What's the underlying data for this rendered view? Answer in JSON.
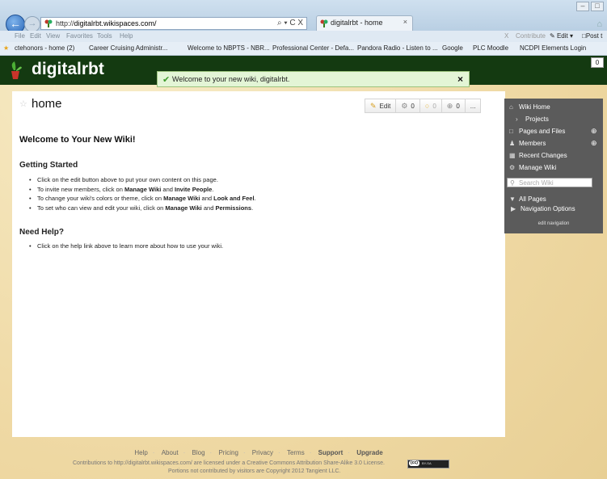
{
  "browser": {
    "url_prefix": "http://",
    "url_host": "digitalrbt.wikispaces.com/",
    "url_controls": "⌕ ▾ C X",
    "tab_title": "digitalrbt - home",
    "tab_close": "×",
    "menu": [
      "File",
      "Edit",
      "View",
      "Favorites",
      "Tools",
      "Help"
    ],
    "commands": {
      "close": "X",
      "contribute": "Contribute",
      "edit": "Edit",
      "post": "Post t"
    },
    "favorites": [
      "ctehonors - home (2)",
      "Career Cruising Administr...",
      "Welcome to NBPTS - NBR...",
      "Professional Center - Defa...",
      "Pandora Radio - Listen to ...",
      "Google",
      "PLC Moodle",
      "NCDPI Elements Login"
    ]
  },
  "wiki": {
    "site_title": "digitalrbt",
    "header_count": "0",
    "notice": "Welcome to your new wiki, digitalrbt.",
    "notice_close": "×",
    "page_title": "home",
    "toolbar": {
      "edit": "Edit",
      "history_count": "0",
      "comments_count": "0",
      "follow_count": "0",
      "more": "..."
    },
    "content": {
      "welcome_heading": "Welcome to Your New Wiki!",
      "getting_started_heading": "Getting Started",
      "gs_items": [
        {
          "text": "Click on the edit button above to put your own content on this page."
        },
        {
          "pre": "To invite new members, click on ",
          "b1": "Manage Wiki",
          "mid": " and ",
          "b2": "Invite People",
          "post": "."
        },
        {
          "pre": "To change your wiki's colors or theme, click on ",
          "b1": "Manage Wiki",
          "mid": " and ",
          "b2": "Look and Feel",
          "post": "."
        },
        {
          "pre": "To set who can view and edit your wiki, click on ",
          "b1": "Manage Wiki",
          "mid": " and ",
          "b2": "Permissions",
          "post": "."
        }
      ],
      "need_help_heading": "Need Help?",
      "help_item": "Click on the help link above to learn more about how to use your wiki."
    },
    "sidebar": {
      "wiki_home": "Wiki Home",
      "projects": "Projects",
      "pages_files": "Pages and Files",
      "members": "Members",
      "recent_changes": "Recent Changes",
      "manage_wiki": "Manage Wiki",
      "search_placeholder": "Search Wiki",
      "all_pages": "All Pages",
      "navigation_options": "Navigation Options",
      "edit_navigation": "edit navigation"
    },
    "footer": {
      "links": [
        "Help",
        "About",
        "Blog",
        "Pricing",
        "Privacy",
        "Terms",
        "Support",
        "Upgrade"
      ],
      "license_line": "Contributions to http://digitalrbt.wikispaces.com/ are licensed under a Creative Commons Attribution Share-Alike 3.0 License.",
      "copyright_line": "Portions not contributed by visitors are Copyright 2012 Tangient LLC.",
      "cc_badge_left": "(cc)",
      "cc_badge_right": "BY-SA"
    }
  }
}
